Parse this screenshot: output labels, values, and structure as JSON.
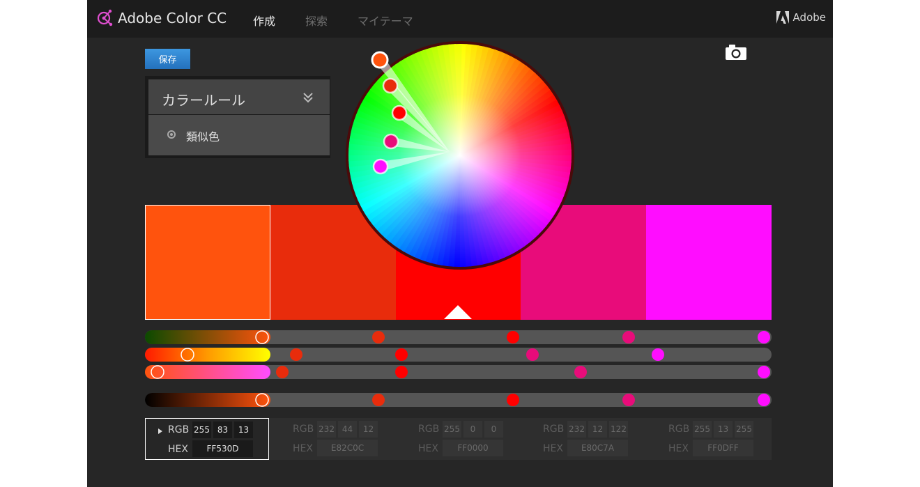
{
  "app": {
    "title": "Adobe Color CC",
    "brand": "Adobe"
  },
  "nav": {
    "items": [
      "作成",
      "探索",
      "マイテーマ"
    ],
    "active": 0
  },
  "toolbar": {
    "save_label": "保存"
  },
  "color_rule": {
    "title": "カラールール",
    "selected_option": "類似色"
  },
  "swatches": [
    {
      "hex": "#FF530D",
      "rgb": [
        255,
        83,
        13
      ],
      "hex_label": "FF530D",
      "selected": true
    },
    {
      "hex": "#E82C0C",
      "rgb": [
        232,
        44,
        12
      ],
      "hex_label": "E82C0C",
      "selected": false
    },
    {
      "hex": "#FF0000",
      "rgb": [
        255,
        0,
        0
      ],
      "hex_label": "FF0000",
      "selected": false
    },
    {
      "hex": "#E80C7A",
      "rgb": [
        232,
        12,
        122
      ],
      "hex_label": "E80C7A",
      "selected": false
    },
    {
      "hex": "#FF0DFF",
      "rgb": [
        255,
        13,
        255
      ],
      "hex_label": "FF0DFF",
      "selected": false
    }
  ],
  "labels": {
    "rgb": "RGB",
    "hex": "HEX"
  },
  "selected_swatch_index": 0,
  "pointer_swatch_index": 2,
  "colors": {
    "background": "#262626",
    "topbar": "#1c1c1c",
    "save_button": "#2f86d6"
  }
}
